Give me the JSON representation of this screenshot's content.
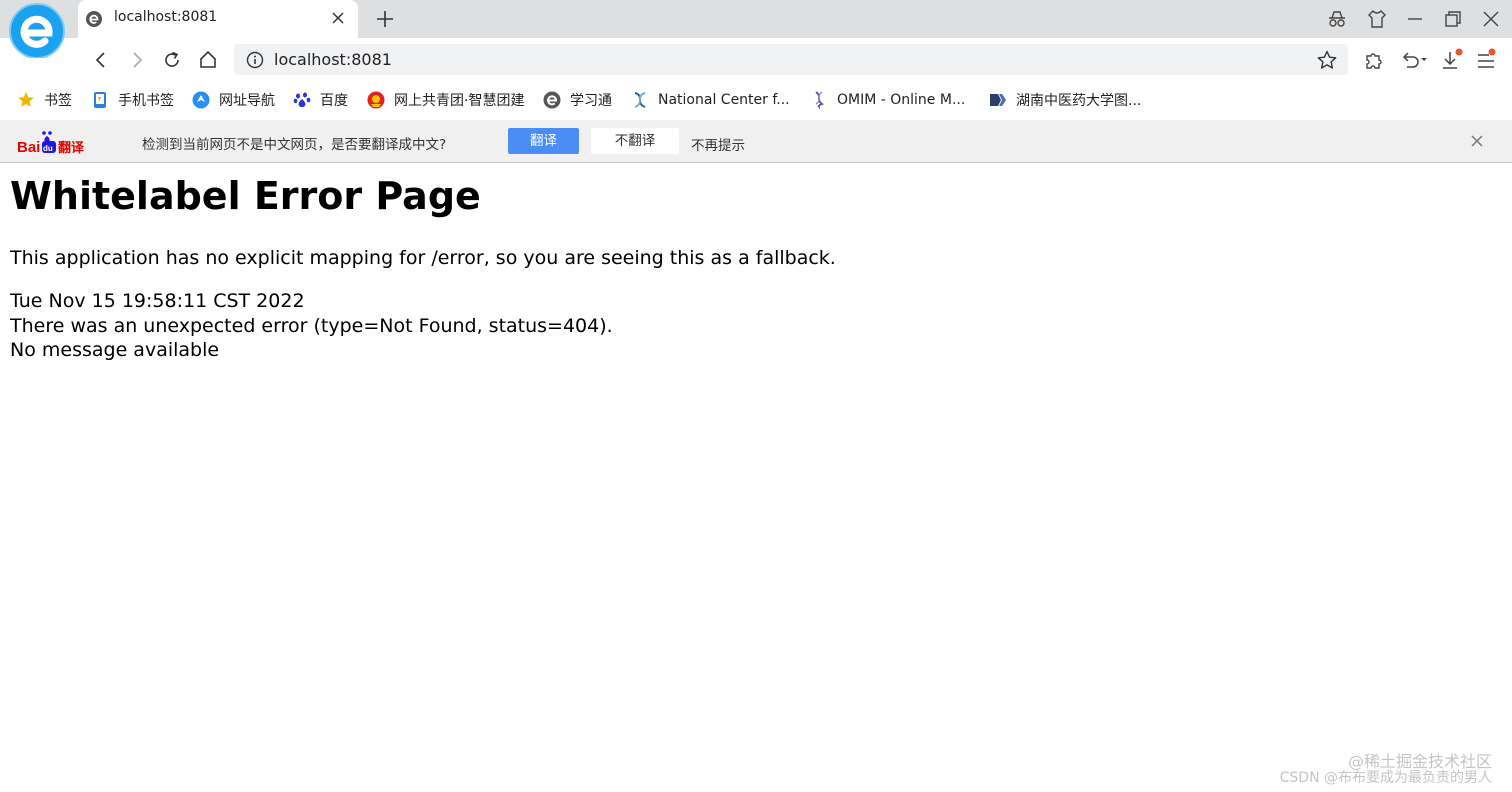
{
  "tab": {
    "title": "localhost:8081"
  },
  "address": {
    "url": "localhost:8081"
  },
  "bookmarks": [
    {
      "label": "书签",
      "icon": "star-icon"
    },
    {
      "label": "手机书签",
      "icon": "phone-icon"
    },
    {
      "label": "网址导航",
      "icon": "navigation-icon"
    },
    {
      "label": "百度",
      "icon": "baidu-paw-icon"
    },
    {
      "label": "网上共青团·智慧团建",
      "icon": "league-emblem-icon"
    },
    {
      "label": "学习通",
      "icon": "e-circle-icon"
    },
    {
      "label": "National Center f...",
      "icon": "ncbi-helix-icon"
    },
    {
      "label": "OMIM - Online M...",
      "icon": "dna-icon"
    },
    {
      "label": "湖南中医药大学图...",
      "icon": "library-icon"
    }
  ],
  "translate_bar": {
    "logo": "Baidu翻译",
    "message": "检测到当前网页不是中文网页，是否要翻译成中文?",
    "translate_button": "翻译",
    "no_translate_button": "不翻译",
    "dont_ask": "不再提示"
  },
  "page": {
    "heading": "Whitelabel Error Page",
    "line1": "This application has no explicit mapping for /error, so you are seeing this as a fallback.",
    "timestamp": "Tue Nov 15 19:58:11 CST 2022",
    "error_line": "There was an unexpected error (type=Not Found, status=404).",
    "message": "No message available"
  },
  "watermark": {
    "line1": "@稀土掘金技术社区",
    "line2": "CSDN @布布要成为最负责的男人"
  },
  "colors": {
    "accent": "#4a8df6",
    "titlebar": "#dedfe1",
    "logo_blue": "#1aa1f0",
    "badge": "#f0522b"
  }
}
